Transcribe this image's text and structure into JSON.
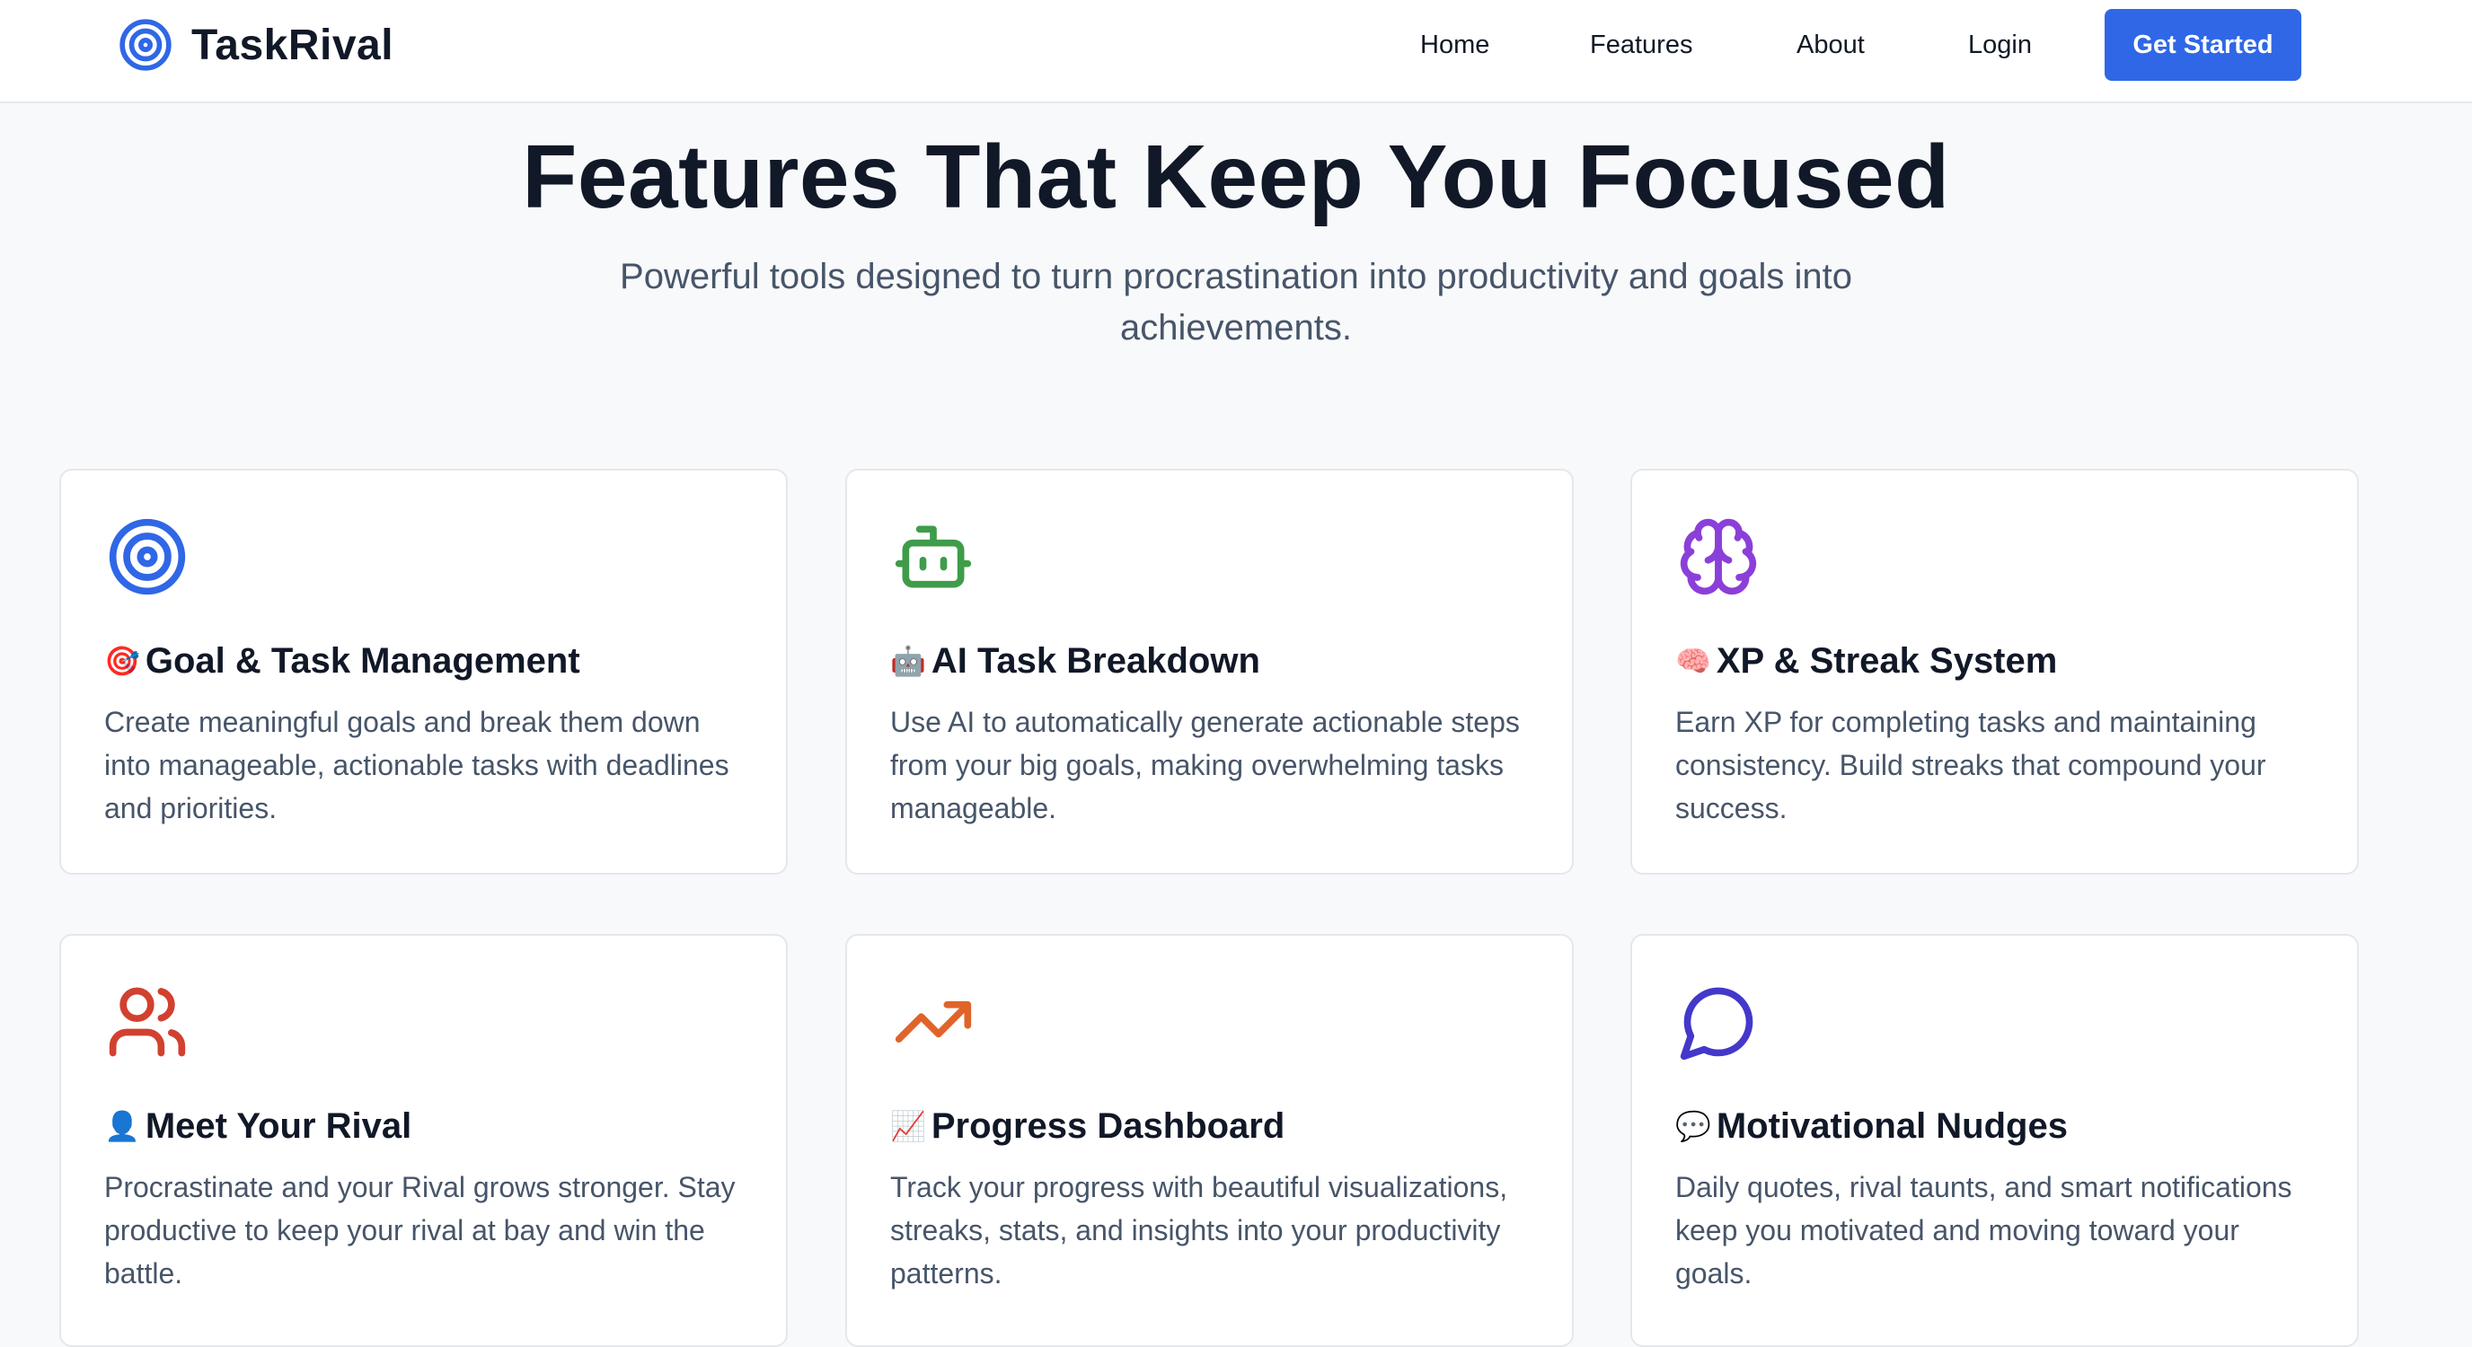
{
  "brand": {
    "name": "TaskRival",
    "logo_icon": "target-icon",
    "accent": "#2f67e6"
  },
  "nav": {
    "links": [
      "Home",
      "Features",
      "About",
      "Login"
    ],
    "cta": "Get Started"
  },
  "hero": {
    "title": "Features That Keep You Focused",
    "subtitle": "Powerful tools designed to turn procrastination into productivity and goals into achievements."
  },
  "features": [
    {
      "icon": "target-icon",
      "icon_color": "#2f67e6",
      "emoji": "🎯",
      "title": "Goal & Task Management",
      "description": "Create meaningful goals and break them down into manageable, actionable tasks with deadlines and priorities."
    },
    {
      "icon": "bot-icon",
      "icon_color": "#3f9c4a",
      "emoji": "🤖",
      "title": "AI Task Breakdown",
      "description": "Use AI to automatically generate actionable steps from your big goals, making overwhelming tasks manageable."
    },
    {
      "icon": "brain-icon",
      "icon_color": "#8b3fd9",
      "emoji": "🧠",
      "title": "XP & Streak System",
      "description": "Earn XP for completing tasks and maintaining consistency. Build streaks that compound your success."
    },
    {
      "icon": "users-icon",
      "icon_color": "#d2402f",
      "emoji": "👤",
      "title": "Meet Your Rival",
      "description": "Procrastinate and your Rival grows stronger. Stay productive to keep your rival at bay and win the battle."
    },
    {
      "icon": "trending-up-icon",
      "icon_color": "#e0642a",
      "emoji": "📈",
      "title": "Progress Dashboard",
      "description": "Track your progress with beautiful visualizations, streaks, stats, and insights into your productivity patterns."
    },
    {
      "icon": "message-circle-icon",
      "icon_color": "#4338ca",
      "emoji": "💬",
      "title": "Motivational Nudges",
      "description": "Daily quotes, rival taunts, and smart notifications keep you motivated and moving toward your goals."
    }
  ]
}
